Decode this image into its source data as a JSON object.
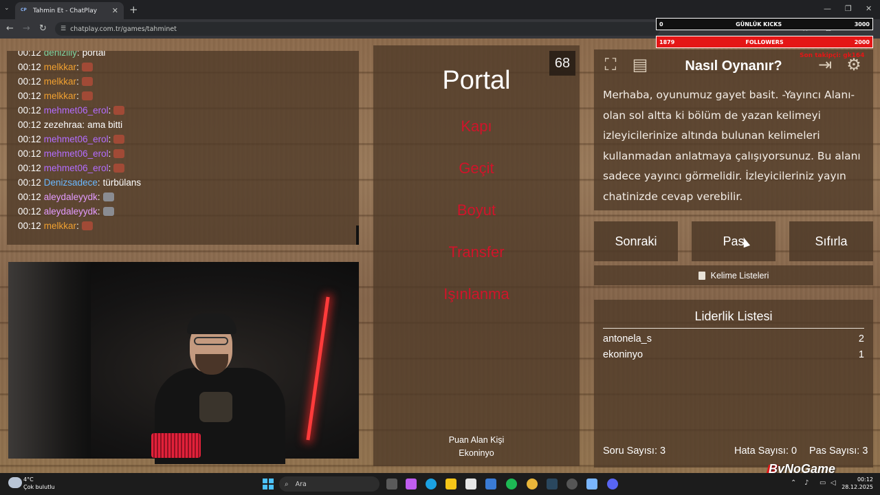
{
  "browser": {
    "tab_title": "Tahmin Et - ChatPlay",
    "tab_favicon": "CP",
    "url": "chatplay.com.tr/games/tahminet"
  },
  "overlay": {
    "kicks_left": "0",
    "kicks_label": "GÜNLÜK KICKS",
    "kicks_right": "3000",
    "followers_left": "1879",
    "followers_label": "FOLLOWERS",
    "followers_right": "2000",
    "red_note": "Son takipçi: gk164"
  },
  "chat": {
    "messages": [
      {
        "time": "00:12",
        "user": "denizlily",
        "color": "#7ed3a0",
        "text": "portal",
        "emote": ""
      },
      {
        "time": "00:12",
        "user": "melkkar",
        "color": "#f0a030",
        "text": "",
        "emote": "red"
      },
      {
        "time": "00:12",
        "user": "melkkar",
        "color": "#f0a030",
        "text": "",
        "emote": "red"
      },
      {
        "time": "00:12",
        "user": "melkkar",
        "color": "#f0a030",
        "text": "",
        "emote": "red"
      },
      {
        "time": "00:12",
        "user": "mehmet06_erol",
        "color": "#b36cff",
        "text": "",
        "emote": "red"
      },
      {
        "time": "00:12",
        "user": "zezehraa",
        "color": "#ffffff",
        "text": "ama bitti",
        "emote": ""
      },
      {
        "time": "00:12",
        "user": "mehmet06_erol",
        "color": "#b36cff",
        "text": "",
        "emote": "red"
      },
      {
        "time": "00:12",
        "user": "mehmet06_erol",
        "color": "#b36cff",
        "text": "",
        "emote": "red"
      },
      {
        "time": "00:12",
        "user": "mehmet06_erol",
        "color": "#b36cff",
        "text": "",
        "emote": "red"
      },
      {
        "time": "00:12",
        "user": "Denizsadece",
        "color": "#6ab8ff",
        "text": "türbülans",
        "emote": ""
      },
      {
        "time": "00:12",
        "user": "aleydaleyydk",
        "color": "#e39bff",
        "text": "",
        "emote": "gray"
      },
      {
        "time": "00:12",
        "user": "aleydaleyydk",
        "color": "#e39bff",
        "text": "",
        "emote": "gray"
      },
      {
        "time": "00:12",
        "user": "melkkar",
        "color": "#f0a030",
        "text": "",
        "emote": "red"
      }
    ]
  },
  "game": {
    "counter": "68",
    "word": "Portal",
    "forbidden": [
      "Kapı",
      "Geçit",
      "Boyut",
      "Transfer",
      "Işınlanma"
    ],
    "scorer_label": "Puan Alan Kişi",
    "scorer_name": "Ekoninyo"
  },
  "howto": {
    "title": "Nasıl Oynanır?",
    "text": "Merhaba, oyunumuz gayet basit. -Yayıncı Alanı- olan sol altta ki bölüm de yazan kelimeyi izleyicilerinize altında bulunan kelimeleri kullanmadan anlatmaya çalışıyorsunuz. Bu alanı sadece yayıncı görmelidir. İzleyicileriniz yayın chatinizde cevap verebilir."
  },
  "buttons": {
    "next": "Sonraki",
    "pass": "Pas",
    "reset": "Sıfırla",
    "word_lists": "Kelime Listeleri"
  },
  "leaderboard": {
    "title": "Liderlik Listesi",
    "rows": [
      {
        "name": "antonela_s",
        "score": "2"
      },
      {
        "name": "ekoninyo",
        "score": "1"
      }
    ],
    "question_count": "Soru Sayısı: 3",
    "error_count": "Hata Sayısı: 0",
    "pass_count": "Pas Sayısı: 3"
  },
  "taskbar": {
    "temperature": "4°C",
    "weather": "Çok bulutlu",
    "search_placeholder": "Ara",
    "time": "00:12",
    "date": "28.12.2025"
  },
  "brand": "ByNoGame"
}
